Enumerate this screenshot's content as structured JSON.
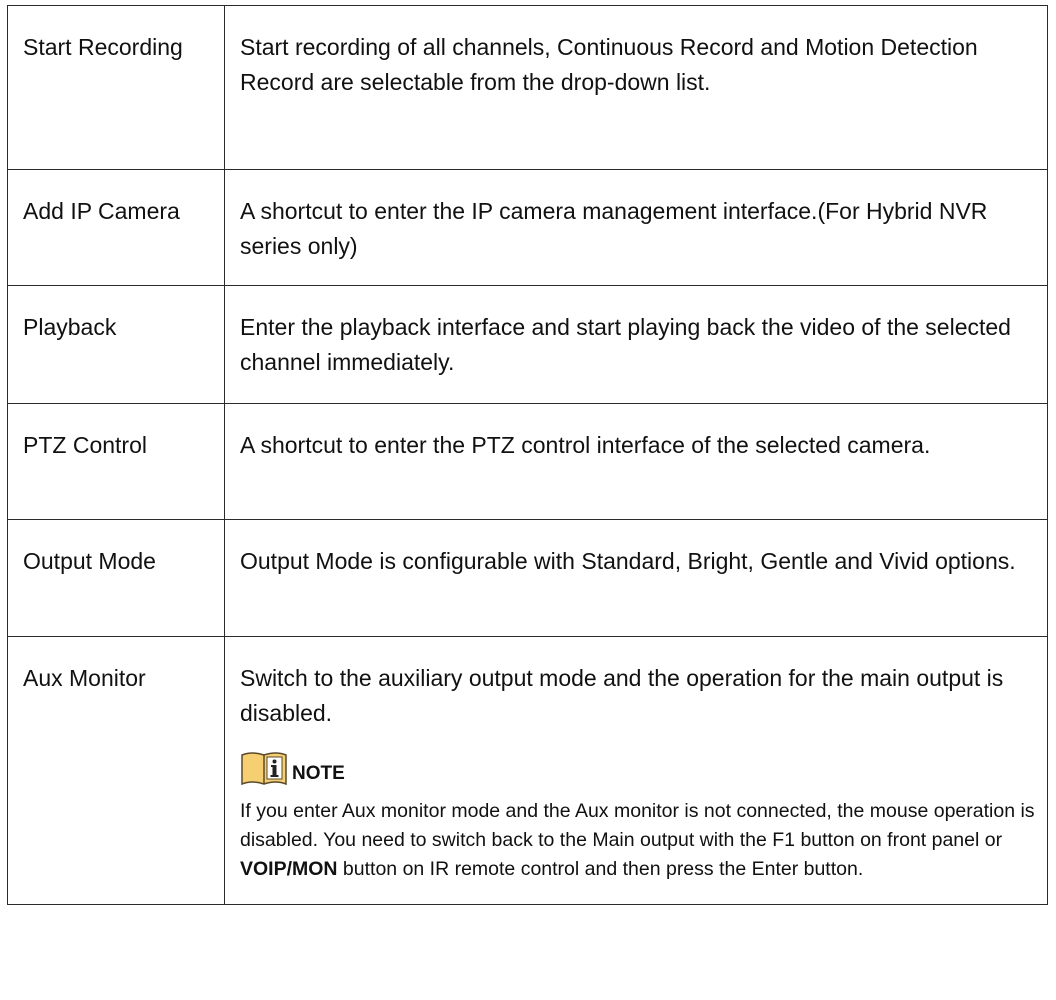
{
  "rows": [
    {
      "name": "Start Recording",
      "description": "Start recording of all channels, Continuous Record and Motion Detection Record are selectable from the drop-down list."
    },
    {
      "name": "Add IP Camera",
      "description": "A shortcut to enter the IP camera management interface.(For Hybrid NVR series only)"
    },
    {
      "name": "Playback",
      "description": "Enter the playback interface and start playing back the video of the selected channel immediately."
    },
    {
      "name": "PTZ Control",
      "description": "A shortcut to enter the PTZ control interface of the selected camera."
    },
    {
      "name": "Output Mode",
      "description": "Output Mode is configurable with Standard, Bright, Gentle and Vivid options."
    },
    {
      "name": "Aux Monitor",
      "description": "Switch to the auxiliary output mode and the operation for the main output is disabled."
    }
  ],
  "note": {
    "icon": "note-info-icon",
    "label": "NOTE",
    "text_part1": " If you enter Aux monitor mode and the Aux monitor is not connected, the mouse operation is disabled. You need to switch back to the Main output with the F1 button on front panel or ",
    "text_bold": "VOIP/MON",
    "text_part2": " button on IR remote control and then press the Enter button."
  },
  "colors": {
    "border": "#2b2b2b",
    "icon_fill": "#f6cf73",
    "icon_stroke": "#5a4a2a",
    "text": "#111111"
  }
}
